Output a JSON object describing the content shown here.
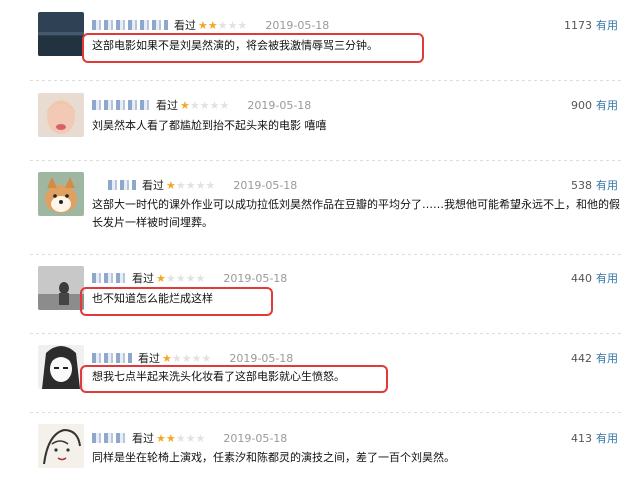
{
  "status": "看过",
  "useful_label": "有用",
  "colors": {
    "star_on": "#f5a623",
    "star_off": "#e2e2e2",
    "link": "#3377aa",
    "highlight": "#e03a3a"
  },
  "reviews": [
    {
      "rating": 2,
      "time": "2019-05-18",
      "votes": "1173",
      "content": "这部电影如果不是刘昊然演的，将会被我激情辱骂三分钟。",
      "highlighted": true,
      "avatar": "dark-landscape"
    },
    {
      "rating": 1,
      "time": "2019-05-18",
      "votes": "900",
      "content": "刘昊然本人看了都尴尬到抬不起头来的电影 嘻嘻",
      "highlighted": false,
      "avatar": "child-portrait"
    },
    {
      "rating": 1,
      "time": "2019-05-18",
      "votes": "538",
      "content": "这部大一时代的课外作业可以成功拉低刘昊然作品在豆瓣的平均分了……我想他可能希望永远不上，和他的假长发片一样被时间埋葬。",
      "highlighted": false,
      "avatar": "shiba-dog"
    },
    {
      "rating": 1,
      "time": "2019-05-18",
      "votes": "440",
      "content": "也不知道怎么能烂成这样",
      "highlighted": true,
      "avatar": "grey-figure"
    },
    {
      "rating": 1,
      "time": "2019-05-18",
      "votes": "442",
      "content": "想我七点半起来洗头化妆看了这部电影就心生愤怒。",
      "highlighted": true,
      "avatar": "manga-face"
    },
    {
      "rating": 2,
      "time": "2019-05-18",
      "votes": "413",
      "content": "同样是坐在轮椅上演戏，任素汐和陈都灵的演技之间，差了一百个刘昊然。",
      "highlighted": false,
      "avatar": "manga-sketch"
    }
  ]
}
